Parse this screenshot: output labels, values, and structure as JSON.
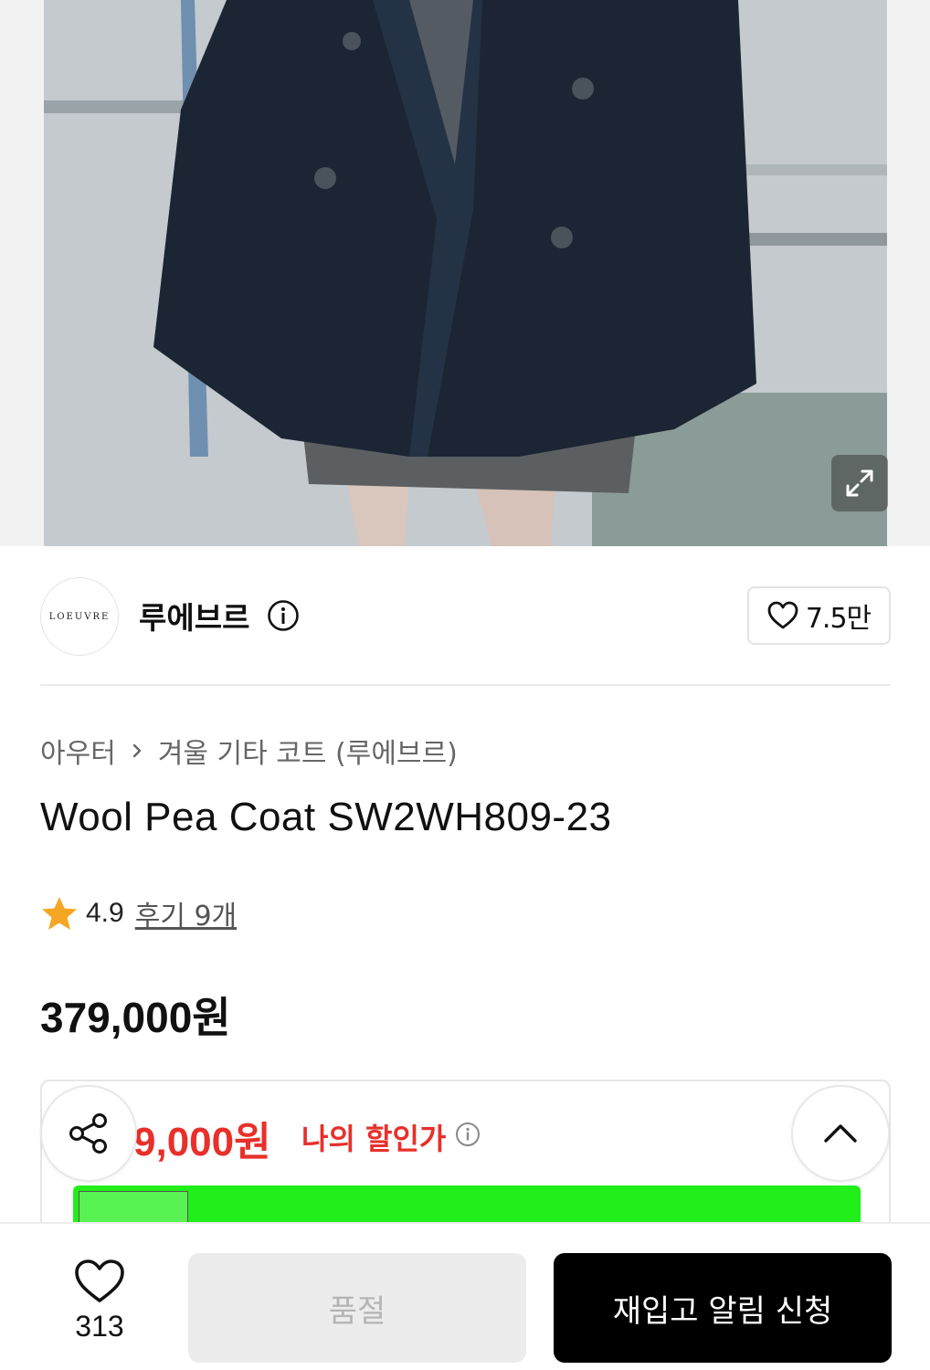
{
  "brand": {
    "logo_text": "LOEUVRE",
    "name": "루에브르",
    "likes": "7.5만"
  },
  "breadcrumb": {
    "parent": "아우터",
    "child": "겨울 기타 코트 (루에브르)"
  },
  "product": {
    "title": "Wool Pea Coat SW2WH809-23",
    "rating": "4.9",
    "review_link": "후기 9개",
    "price": "379,000원"
  },
  "discount": {
    "price": "9,000원",
    "label": "나의 할인가"
  },
  "bottom_bar": {
    "wish_count": "313",
    "soldout_label": "품절",
    "restock_label": "재입고 알림 신청"
  },
  "colors": {
    "accent_red": "#e8302a",
    "banner_green": "#22ee1a",
    "cta_black": "#000000",
    "star": "#f5a623"
  },
  "icons": [
    "expand-icon",
    "info-icon",
    "heart-icon",
    "chevron-right-icon",
    "star-icon",
    "share-icon",
    "chevron-up-icon"
  ]
}
